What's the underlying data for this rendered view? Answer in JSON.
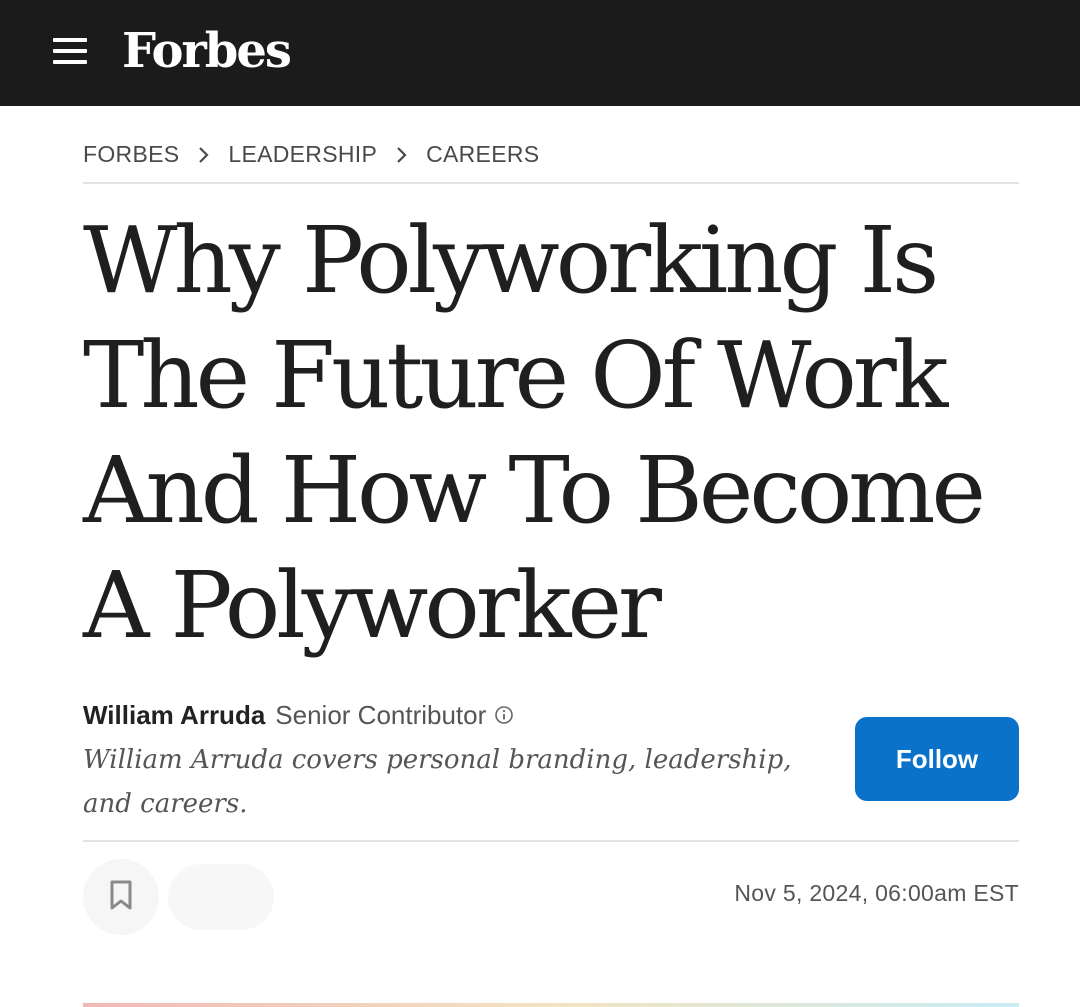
{
  "header": {
    "logo": "Forbes",
    "menu_icon": "hamburger-menu-icon",
    "background_color": "#1b1b1b"
  },
  "breadcrumb": {
    "items": [
      "FORBES",
      "LEADERSHIP",
      "CAREERS"
    ],
    "separator_icon": "chevron-right-icon"
  },
  "article": {
    "headline": "Why Polyworking Is The Future Of Work And How To Become A Polyworker",
    "author": {
      "name": "William Arruda",
      "role": "Senior Contributor",
      "role_icon": "info-icon",
      "bio": "William Arruda covers personal branding, leadership, and careers."
    },
    "follow_label": "Follow",
    "follow_color": "#0b72c9",
    "save_icon": "bookmark-icon",
    "date": "Nov 5, 2024, 06:00am EST"
  }
}
